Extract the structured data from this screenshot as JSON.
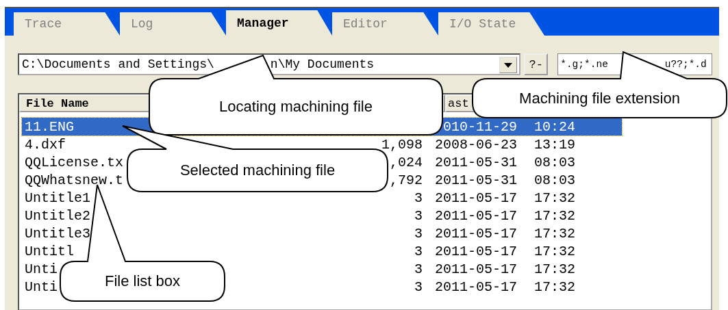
{
  "tabs": [
    {
      "label": "Trace",
      "selected": false
    },
    {
      "label": "Log",
      "selected": false
    },
    {
      "label": "Manager",
      "selected": true
    },
    {
      "label": "Editor",
      "selected": false
    },
    {
      "label": "I/O State",
      "selected": false
    }
  ],
  "path_field": {
    "value_start": "C:\\Documents and Settings\\",
    "value_end": "n\\My Documents"
  },
  "help_button": "?-",
  "extension_field": {
    "value_start": "*.g;*.ne",
    "value_end": "u??;*.d"
  },
  "file_list": {
    "header": {
      "column_1": "File Name",
      "column_3": "ast"
    },
    "rows": [
      {
        "name": "11.ENG",
        "date": "010-11-29",
        "time": "10:24",
        "selected": true
      },
      {
        "name": "4.dxf",
        "size": "1,098",
        "date": "2008-06-23",
        "time": "13:19",
        "selected": false
      },
      {
        "name": "QQLicense.tx",
        "size": ",024",
        "date": "2011-05-31",
        "time": "08:03",
        "selected": false
      },
      {
        "name": "QQWhatsnew.t",
        "size": ",792",
        "date": "2011-05-31",
        "time": "08:03",
        "selected": false
      },
      {
        "name": "Untitle1",
        "size": "3",
        "date": "2011-05-17",
        "time": "17:32",
        "selected": false
      },
      {
        "name": "Untitle2",
        "size": "3",
        "date": "2011-05-17",
        "time": "17:32",
        "selected": false
      },
      {
        "name": "Untitle3",
        "size": "3",
        "date": "2011-05-17",
        "time": "17:32",
        "selected": false
      },
      {
        "name": "Untitl",
        "size": "3",
        "date": "2011-05-17",
        "time": "17:32",
        "selected": false
      },
      {
        "name": "Unti",
        "size": "3",
        "date": "2011-05-17",
        "time": "17:32",
        "selected": false
      },
      {
        "name": "Unti",
        "size": "3",
        "date": "2011-05-17",
        "time": "17:32",
        "selected": false
      }
    ]
  },
  "callouts": [
    "Locating machining file",
    "Machining file extension",
    "Selected machining file",
    "File list box"
  ]
}
